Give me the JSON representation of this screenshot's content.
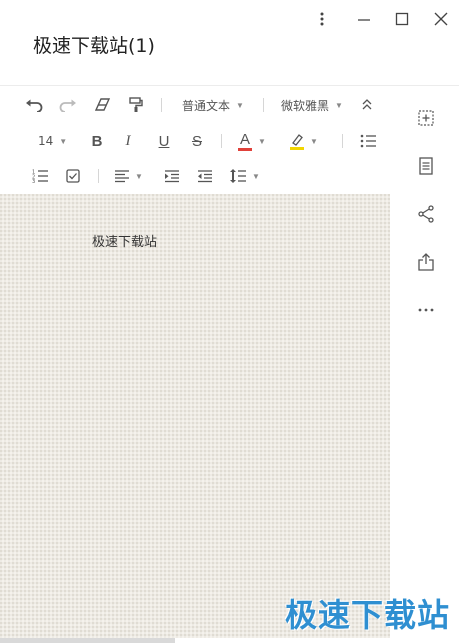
{
  "window": {
    "title": "极速下载站(1)",
    "controls": [
      "more-vertical-icon",
      "minimize-icon",
      "maximize-icon",
      "close-icon"
    ]
  },
  "toolbar": {
    "row1": {
      "undo_icon": "undo-icon",
      "redo_icon": "redo-icon",
      "eraser_icon": "eraser-icon",
      "format_painter_icon": "format-painter-icon",
      "paragraph_style": "普通文本",
      "font_family": "微软雅黑",
      "collapse_icon": "collapse-icon"
    },
    "row2": {
      "font_size": "14",
      "bold": "B",
      "italic": "I",
      "underline": "U",
      "strikethrough": "S",
      "font_color_glyph": "A",
      "font_color": "#e0413a",
      "highlight_color": "#f2d600",
      "bullet_list_icon": "bullet-list-icon"
    },
    "row3": {
      "numbered_list_icon": "numbered-list-icon",
      "checklist_icon": "checklist-icon",
      "align_icon": "align-left-icon",
      "indent_icon": "indent-increase-icon",
      "outdent_icon": "indent-decrease-icon",
      "line_height_icon": "line-height-icon"
    }
  },
  "editor": {
    "content": "极速下载站"
  },
  "right_panel": {
    "items": [
      "add-note-icon",
      "note-list-icon",
      "share-icon",
      "export-icon",
      "more-horizontal-icon"
    ]
  },
  "watermark": {
    "text": "极速下载站",
    "color": "#2f8fd1"
  }
}
